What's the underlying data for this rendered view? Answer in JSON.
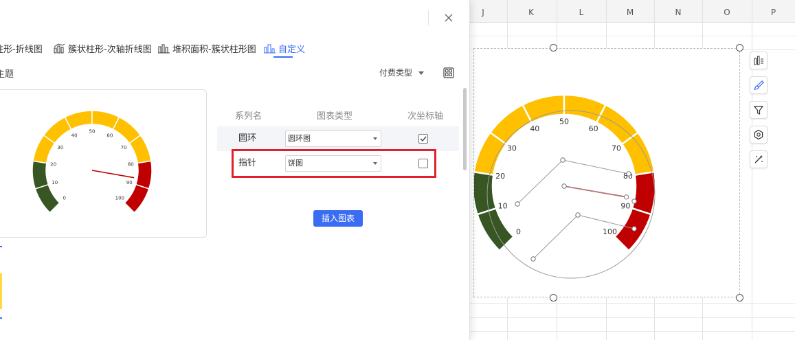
{
  "sheet": {
    "columns": [
      "J",
      "K",
      "L",
      "M",
      "N",
      "O",
      "P"
    ]
  },
  "dialog": {
    "tabs": [
      {
        "label": "柱形-折线图",
        "icon": "combo-chart-icon",
        "active": false
      },
      {
        "label": "簇状柱形-次轴折线图",
        "icon": "combo-chart-icon",
        "active": false
      },
      {
        "label": "堆积面积-簇状柱形图",
        "icon": "area-bar-chart-icon",
        "active": false
      },
      {
        "label": "自定义",
        "icon": "custom-chart-icon",
        "active": true
      }
    ],
    "theme_label": "主题",
    "pay_type_filter": "付费类型",
    "table": {
      "headers": {
        "series_name": "系列名",
        "chart_type": "图表类型",
        "secondary_axis": "次坐标轴"
      },
      "rows": [
        {
          "name": "圆环",
          "type": "圆环图",
          "secondary_axis": true
        },
        {
          "name": "指针",
          "type": "饼图",
          "secondary_axis": false
        }
      ]
    },
    "insert_button": "插入图表"
  },
  "accent_color": "#3a6cf4",
  "highlight_color": "#e0202a",
  "chart_data": {
    "type": "gauge",
    "ticks": [
      "0",
      "10",
      "20",
      "30",
      "40",
      "50",
      "60",
      "70",
      "80",
      "90",
      "100"
    ],
    "segments": [
      {
        "from": 0,
        "to": 20,
        "color": "#375623"
      },
      {
        "from": 20,
        "to": 80,
        "color": "#ffc000"
      },
      {
        "from": 80,
        "to": 100,
        "color": "#c00000"
      }
    ],
    "needle_value": 87,
    "needle_color": "#c00000"
  }
}
